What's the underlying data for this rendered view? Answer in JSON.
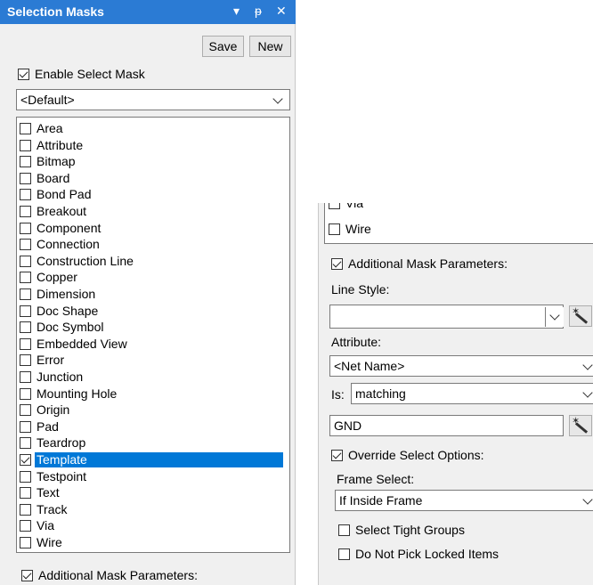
{
  "left_panel": {
    "title": "Selection Masks",
    "controls": {
      "dropdown_glyph": "▾",
      "pin_glyph": "ᵽ",
      "close_glyph": "✕"
    },
    "save_label": "Save",
    "new_label": "New",
    "enable_select_mask": {
      "label": "Enable Select Mask",
      "checked": true
    },
    "mask_dropdown": {
      "value": "<Default>"
    },
    "items": [
      {
        "label": "Area",
        "checked": false
      },
      {
        "label": "Attribute",
        "checked": false
      },
      {
        "label": "Bitmap",
        "checked": false
      },
      {
        "label": "Board",
        "checked": false
      },
      {
        "label": "Bond Pad",
        "checked": false
      },
      {
        "label": "Breakout",
        "checked": false
      },
      {
        "label": "Component",
        "checked": false
      },
      {
        "label": "Connection",
        "checked": false
      },
      {
        "label": "Construction Line",
        "checked": false
      },
      {
        "label": "Copper",
        "checked": false
      },
      {
        "label": "Dimension",
        "checked": false
      },
      {
        "label": "Doc Shape",
        "checked": false
      },
      {
        "label": "Doc Symbol",
        "checked": false
      },
      {
        "label": "Embedded View",
        "checked": false
      },
      {
        "label": "Error",
        "checked": false
      },
      {
        "label": "Junction",
        "checked": false
      },
      {
        "label": "Mounting Hole",
        "checked": false
      },
      {
        "label": "Origin",
        "checked": false
      },
      {
        "label": "Pad",
        "checked": false
      },
      {
        "label": "Teardrop",
        "checked": false
      },
      {
        "label": "Template",
        "checked": true,
        "selected": true
      },
      {
        "label": "Testpoint",
        "checked": false
      },
      {
        "label": "Text",
        "checked": false
      },
      {
        "label": "Track",
        "checked": false
      },
      {
        "label": "Via",
        "checked": false
      },
      {
        "label": "Wire",
        "checked": false
      }
    ],
    "additional_mask": {
      "label": "Additional Mask Parameters:",
      "checked": true
    }
  },
  "right_panel": {
    "list_items": [
      {
        "label": "Via",
        "checked": false
      },
      {
        "label": "Wire",
        "checked": false
      }
    ],
    "additional_mask": {
      "label": "Additional Mask Parameters:",
      "checked": true
    },
    "line_style_label": "Line Style:",
    "line_style_value": "",
    "attribute_label": "Attribute:",
    "attribute_value": "<Net Name>",
    "is_label": "Is:",
    "is_value": "matching",
    "value_text": "GND",
    "override": {
      "label": "Override Select Options:",
      "checked": true
    },
    "frame_select_label": "Frame Select:",
    "frame_select_value": "If Inside Frame",
    "select_tight_groups": {
      "label": "Select Tight Groups",
      "checked": false
    },
    "do_not_pick_locked": {
      "label": "Do Not Pick Locked Items",
      "checked": false
    }
  },
  "colors": {
    "titlebar": "#2b7bd4",
    "selection": "#0078d7",
    "panel_bg": "#f0f0f0"
  }
}
